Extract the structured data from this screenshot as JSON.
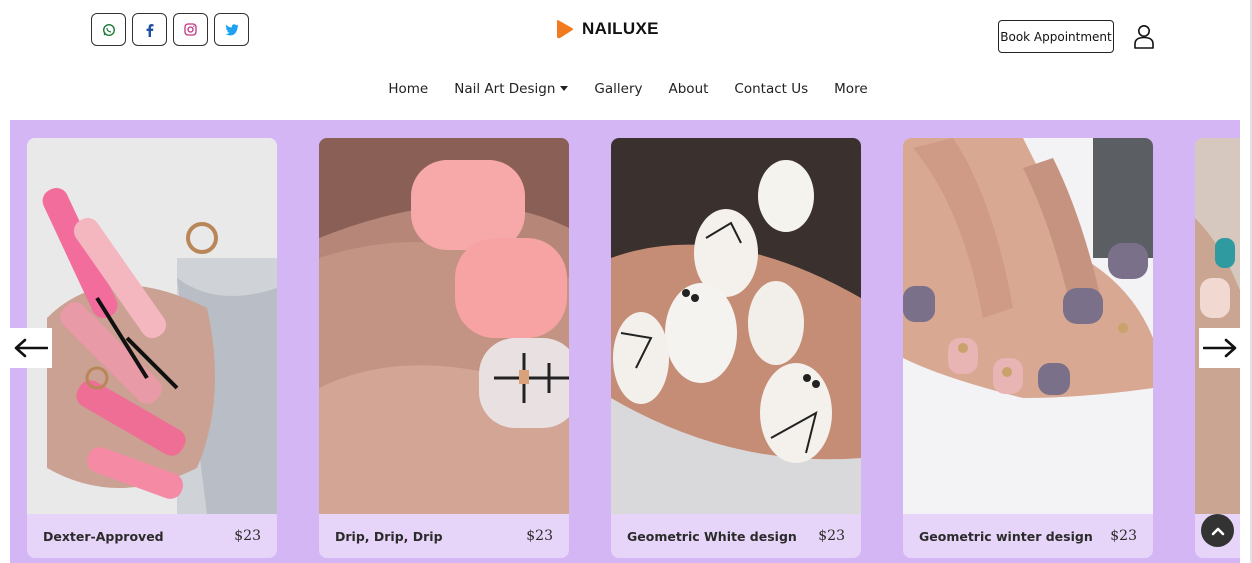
{
  "social": {
    "items": [
      "whatsapp-icon",
      "facebook-icon",
      "instagram-icon",
      "twitter-icon"
    ],
    "colors": {
      "whatsapp": "#1f7a3a",
      "facebook": "#1e4fa3",
      "instagram": "#c13584",
      "twitter": "#1da1f2"
    }
  },
  "brand": {
    "title": "NAILUXE",
    "logo_color": "#f27b1f"
  },
  "header": {
    "book_label": "Book Appointment"
  },
  "nav": {
    "items": [
      "Home",
      "Nail Art Design",
      "Gallery",
      "About",
      "Contact Us",
      "More"
    ]
  },
  "carousel": {
    "background": "#d3b6f3",
    "cards": [
      {
        "title": "Dexter-Approved",
        "price": "$23"
      },
      {
        "title": "Drip, Drip, Drip",
        "price": "$23"
      },
      {
        "title": "Geometric White design",
        "price": "$23"
      },
      {
        "title": "Geometric winter design",
        "price": "$23"
      }
    ]
  }
}
